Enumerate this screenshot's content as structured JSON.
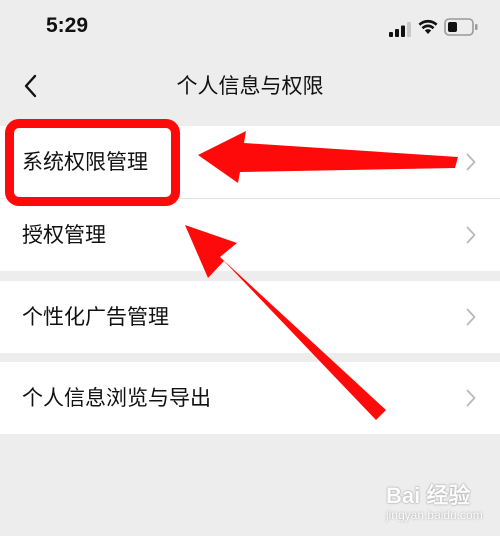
{
  "status_bar": {
    "time": "5:29",
    "icons": [
      "signal-icon",
      "wifi-icon",
      "battery-icon"
    ]
  },
  "nav": {
    "back_icon": "chevron-left-icon",
    "title": "个人信息与权限"
  },
  "menu": [
    {
      "label": "系统权限管理",
      "icon": "chevron-right-icon"
    },
    {
      "label": "授权管理",
      "icon": "chevron-right-icon"
    },
    {
      "label": "个性化广告管理",
      "icon": "chevron-right-icon"
    },
    {
      "label": "个人信息浏览与导出",
      "icon": "chevron-right-icon"
    }
  ],
  "annotation": {
    "color": "#ff0a0a"
  },
  "watermark": {
    "logo": "Bai 经验",
    "sub": "jingyan.baidu.com"
  },
  "colors": {
    "background": "#ededed",
    "row_background": "#ffffff",
    "text": "#111111",
    "chevron": "#b9b9b9"
  }
}
